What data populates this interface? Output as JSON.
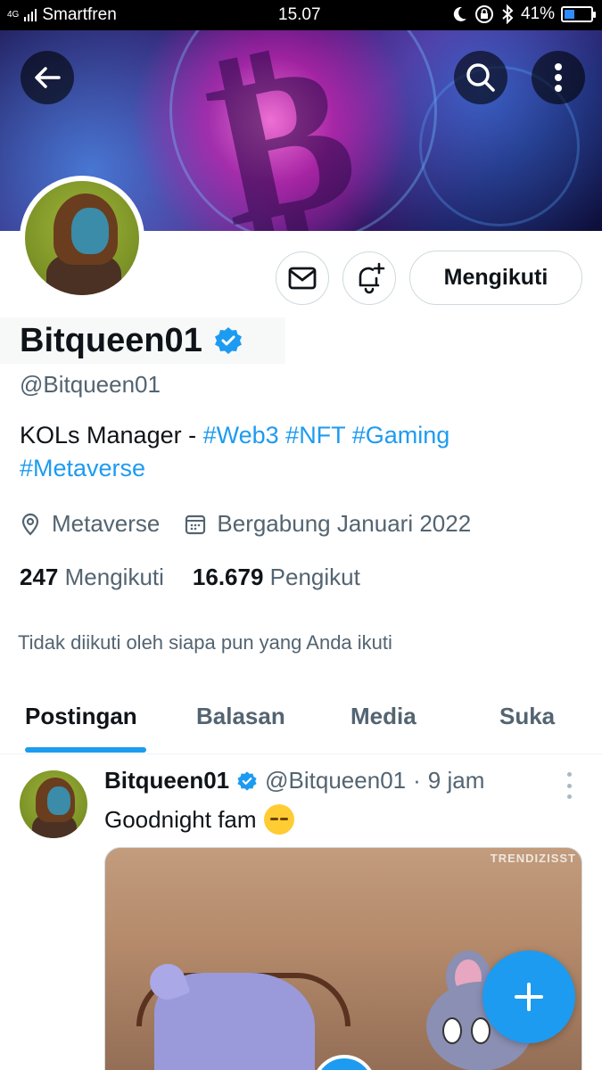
{
  "status_bar": {
    "carrier": "Smartfren",
    "network": "4G",
    "time": "15.07",
    "battery": "41%",
    "battery_level": 0.41
  },
  "header": {
    "back_icon": "arrow-left-icon",
    "search_icon": "search-icon",
    "more_icon": "more-vertical-icon"
  },
  "profile": {
    "name": "Bitqueen01",
    "handle": "@Bitqueen01",
    "verified": true,
    "bio_text": "KOLs Manager - ",
    "bio_tags": [
      "#Web3",
      "#NFT",
      "#Gaming",
      "#Metaverse"
    ],
    "location": "Metaverse",
    "joined": "Bergabung Januari 2022",
    "following_count": "247",
    "following_label": "Mengikuti",
    "followers_count": "16.679",
    "followers_label": "Pengikut",
    "not_followed_text": "Tidak diikuti oleh siapa pun yang Anda ikuti"
  },
  "actions": {
    "message_icon": "envelope-icon",
    "notify_icon": "bell-plus-icon",
    "follow_label": "Mengikuti"
  },
  "tabs": [
    {
      "label": "Postingan",
      "active": true
    },
    {
      "label": "Balasan",
      "active": false
    },
    {
      "label": "Media",
      "active": false
    },
    {
      "label": "Suka",
      "active": false
    }
  ],
  "post": {
    "name": "Bitqueen01",
    "handle": "@Bitqueen01",
    "separator": "·",
    "time": "9 jam",
    "text": "Goodnight fam",
    "emoji": "sleeping-face-emoji",
    "media_watermark": "TRENDIZISST"
  },
  "fab": {
    "icon": "plus-icon"
  },
  "colors": {
    "accent": "#1d9bf0",
    "text_primary": "#0f1419",
    "text_secondary": "#536471"
  }
}
